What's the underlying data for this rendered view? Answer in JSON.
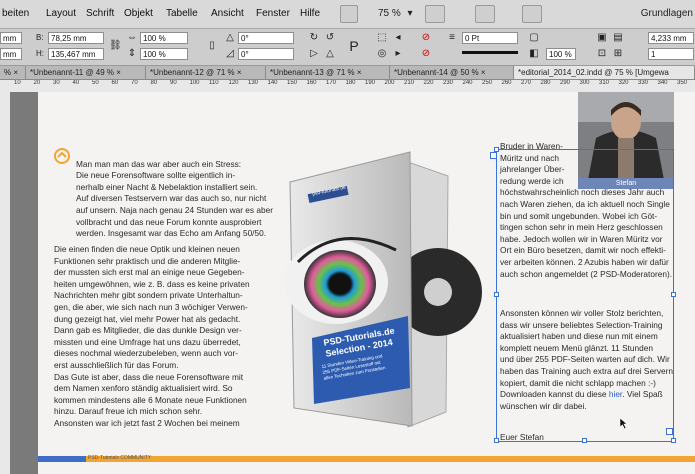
{
  "menubar": {
    "items": [
      "beiten",
      "Layout",
      "Schrift",
      "Objekt",
      "Tabelle",
      "Ansicht",
      "Fenster",
      "Hilfe"
    ],
    "zoom": "75 %",
    "workspace": "Grundlagen"
  },
  "control": {
    "b_label": "B:",
    "b_value": "78,25 mm",
    "h_label": "H:",
    "h_value": "135,467 mm",
    "x_value": "mm",
    "y_value": "mm",
    "scale_x": "100 %",
    "scale_y": "100 %",
    "angle": "0°",
    "shear": "0°",
    "stroke_weight": "0 Pt",
    "stroke_scale": "100 %",
    "ref_value": "4,233 mm",
    "ref_value2": "1"
  },
  "tabs": [
    {
      "label": "%  ×",
      "active": false
    },
    {
      "label": "*Unbenannt-11 @ 49 %  ×",
      "active": false
    },
    {
      "label": "*Unbenannt-12 @ 71 %  ×",
      "active": false
    },
    {
      "label": "*Unbenannt-13 @ 71 %  ×",
      "active": false
    },
    {
      "label": "*Unbenannt-14 @ 50 %  ×",
      "active": false
    },
    {
      "label": "*editorial_2014_02.indd @ 75 % [Umgewa",
      "active": true
    }
  ],
  "ruler": {
    "numbers": [
      "10",
      "20",
      "30",
      "40",
      "50",
      "60",
      "70",
      "80",
      "90",
      "100",
      "110",
      "120",
      "130",
      "140",
      "150",
      "160",
      "170",
      "180",
      "190",
      "200",
      "210",
      "220",
      "230",
      "240",
      "250",
      "260",
      "270",
      "280",
      "290",
      "300",
      "310",
      "320",
      "330",
      "340",
      "350"
    ]
  },
  "page": {
    "left_col_p1": "Man man man das war aber auch ein Stress:\nDie neue Forensoftware sollte eigentlich in-\nnerhalb einer Nacht & Nebelaktion installiert sein.\nAuf diversen Testservern war das auch so, nur nicht\nauf unsern. Naja nach genau 24 Stunden war es aber\nvollbracht und das neue Forum konnte ausprobiert\nwerden. Insgesamt war das Echo am Anfang 50/50.",
    "left_col_p2": "Die einen finden die neue Optik und kleinen neuen\nFunktionen sehr praktisch und die anderen Mitglie-\nder mussten sich erst mal an einige neue Gegeben-\nheiten umgewöhnen, wie z. B. dass es keine privaten\nNachrichten mehr gibt sondern private Unterhaltun-\ngen, die aber, wie sich nach nun 3 wöchiger Verwen-\ndung gezeigt hat, viel mehr Power hat als gedacht.\nDann gab es Mitglieder, die das dunkle Design ver-\nmissten und eine Umfrage hat uns dazu überredet,\ndieses nochmal wiederzubeleben, wenn auch vor-\nerst ausschließlich für das Forum.\nDas Gute ist aber, dass die neue Forensoftware mit\ndem Namen xenforo ständig aktualisiert wird. So\nkommen mindestens alle 6 Monate neue Funktionen\nhinzu. Darauf freue ich mich schon sehr.\nAnsonsten war ich jetzt fast 2 Wochen bei meinem",
    "right_col_p1": "Bruder in Waren-\nMüritz und nach\njahrelanger Über-\nredung werde ich\nhöchstwahrscheinlich noch dieses Jahr auch\nnach Waren ziehen, da ich aktuell noch Single\nbin und somit ungebunden. Wobei ich Göt-\ntingen schon sehr in mein Herz geschlossen\nhabe. Jedoch wollen wir in Waren Müritz vor\nOrt ein Büro besetzen, damit wir noch effekti-\nver arbeiten können. 2 Azubis haben wir dafür\nauch schon angemeldet (2 PSD-Moderatoren).",
    "right_col_p2_a": "Ansonsten können wir voller Stolz berichten,\ndass wir unsere beliebtes Selection-Training\naktualisiert haben und diese nun mit einem\nkomplett neuem Menü glänzt. 11 Stunden\nund über 255 PDF-Seiten warten auf dich. Wir\nhaben das Training auch extra auf drei Servern\nkopiert, damit die nicht schlapp machen :-)\nDownloaden kannst du diese ",
    "right_col_link": "hier",
    "right_col_p2_b": ". Viel Spaß\nwünschen wir dir dabei.",
    "signoff": "Euer Stefan",
    "photo_caption": "Stefan",
    "box_brand": "psd-tutorials.de",
    "box_title": "PSD-Tutorials.de\nSelection - 2014",
    "box_sub": "11 Stunden Video-Training und\n255 PDF-Seiten Lesestoff mit\nallen Techniken zum Freistellen",
    "footer_text": "PSD-Tutorials COMMUNITY"
  },
  "colors": {
    "accent_orange": "#f2a531",
    "selection_blue": "#3c72d6",
    "footer_blue": "#3f6ec7"
  }
}
